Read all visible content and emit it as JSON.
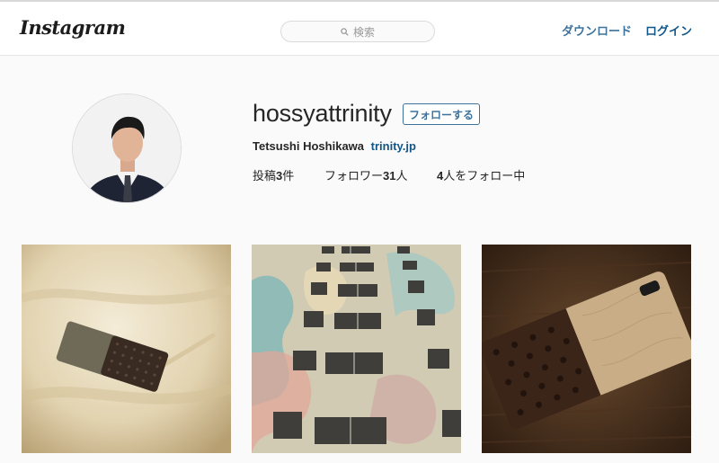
{
  "header": {
    "logo": "Instagram",
    "search_placeholder": "検索",
    "download_label": "ダウンロード",
    "login_label": "ログイン"
  },
  "profile": {
    "username": "hossyattrinity",
    "follow_label": "フォローする",
    "full_name": "Tetsushi Hoshikawa",
    "website": "trinity.jp",
    "stats": {
      "posts_prefix": "投稿",
      "posts_count": "3",
      "posts_suffix": "件",
      "followers_prefix": "フォロワー",
      "followers_count": "31",
      "followers_suffix": "人",
      "following_count": "4",
      "following_suffix": "人をフォロー中"
    }
  },
  "posts": [
    {
      "subject": "phone-case-on-bedsheet"
    },
    {
      "subject": "graffiti-building"
    },
    {
      "subject": "wooden-phone-case"
    }
  ],
  "colors": {
    "link_blue": "#125688",
    "button_blue": "#3f729b",
    "background": "#fafafa"
  }
}
